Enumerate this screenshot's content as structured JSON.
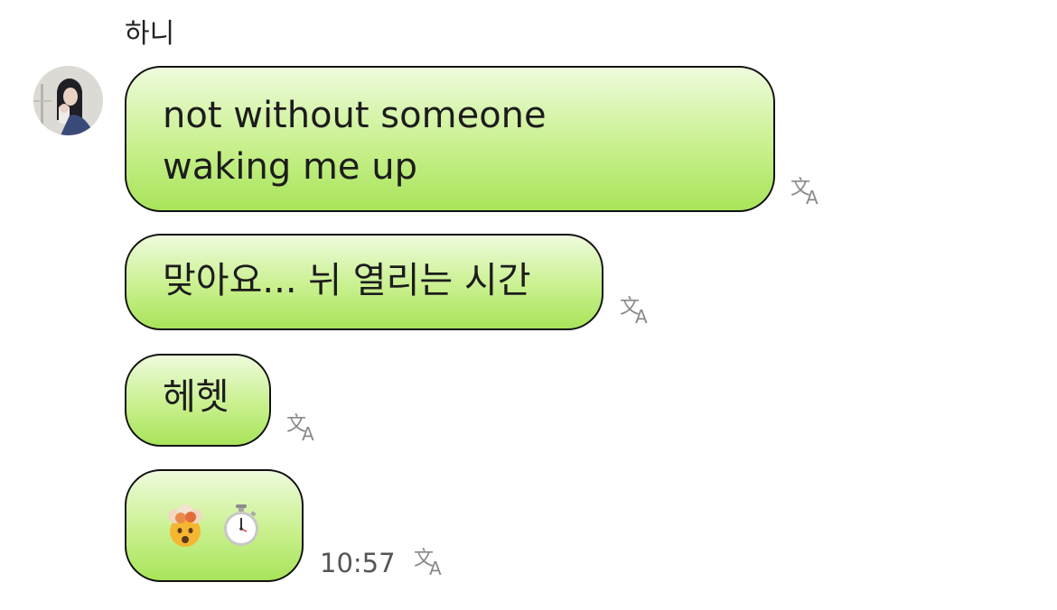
{
  "chat": {
    "sender_name": "하니",
    "avatar_icon": "profile-photo",
    "bubble_color": "#b8ea70",
    "messages": [
      {
        "lines": [
          "not without someone",
          "waking me up"
        ],
        "translate_icon": "translate-icon"
      },
      {
        "text": "맞아요... 뉘 열리는 시간",
        "translate_icon": "translate-icon"
      },
      {
        "text": "헤헷",
        "translate_icon": "translate-icon"
      },
      {
        "emojis": [
          "exploding-head-emoji",
          "stopwatch-emoji"
        ],
        "time": "10:57",
        "translate_icon": "translate-icon"
      }
    ]
  }
}
